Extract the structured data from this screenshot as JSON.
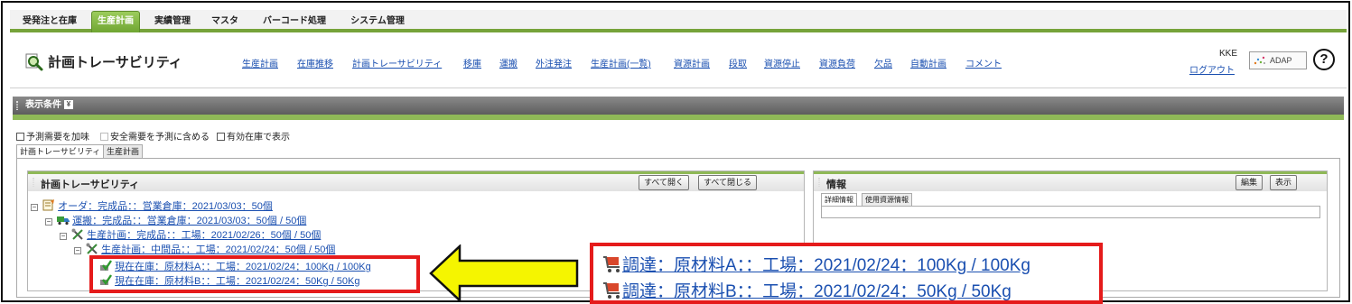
{
  "topnav": {
    "items": [
      {
        "label": "受発注と在庫",
        "active": false
      },
      {
        "label": "生産計画",
        "active": true
      },
      {
        "label": "実績管理",
        "active": false
      },
      {
        "label": "マスタ",
        "active": false
      },
      {
        "label": "バーコード処理",
        "active": false
      },
      {
        "label": "システム管理",
        "active": false
      }
    ]
  },
  "header": {
    "title": "計画トレーサビリティ",
    "title_icon": "magnifier-icon",
    "links": [
      "生産計画",
      "在庫推移",
      "計画トレーサビリティ",
      "移庫",
      "運搬",
      "外注発注",
      "生産計画(一覧)",
      "資源計画",
      "段取",
      "資源停止",
      "資源負荷",
      "欠品",
      "自動計画",
      "コメント"
    ],
    "user": "KKE",
    "logout": "ログアウト",
    "logo_text": "ADAP",
    "help": "?"
  },
  "conditions": {
    "bar_label": "表示条件",
    "toggle_glyph": "¥",
    "options": [
      {
        "label": "予測需要を加味",
        "checked": false,
        "enabled": true
      },
      {
        "label": "安全需要を予測に含める",
        "checked": false,
        "enabled": false
      },
      {
        "label": "有効在庫で表示",
        "checked": false,
        "enabled": true
      }
    ]
  },
  "tabs": [
    {
      "label": "計画トレーサビリティ",
      "active": true
    },
    {
      "label": "生産計画",
      "active": false
    }
  ],
  "trace_panel": {
    "title": "計画トレーサビリティ",
    "expand_all": "すべて開く",
    "collapse_all": "すべて閉じる",
    "tree": [
      {
        "text": "オーダ：完成品：：営業倉庫：2021/03/03：50個",
        "icon": "order-icon",
        "toggle": "⊟"
      },
      {
        "text": "運搬：完成品：：営業倉庫：2021/03/03：50個 / 50個",
        "icon": "truck-icon",
        "toggle": "⊟"
      },
      {
        "text": "生産計画：完成品：：工場：2021/02/26：50個 / 50個",
        "icon": "tools-icon",
        "toggle": "⊟"
      },
      {
        "text": "生産計画：中間品：：工場：2021/02/24：50個 / 50個",
        "icon": "tools-icon",
        "toggle": "⊟"
      },
      {
        "text": "現在在庫：原材料A：：工場：2021/02/24：100Kg / 100Kg",
        "icon": "stock-check-icon",
        "toggle": ""
      },
      {
        "text": "現在在庫：原材料B：：工場：2021/02/24：50Kg / 50Kg",
        "icon": "stock-check-icon",
        "toggle": ""
      }
    ]
  },
  "info_panel": {
    "title": "情報",
    "edit": "編集",
    "show": "表示",
    "tabs": [
      "詳細情報",
      "使用資源情報"
    ]
  },
  "callout": {
    "items": [
      {
        "text": "調達：原材料A：：工場：2021/02/24：100Kg / 100Kg",
        "icon": "cart-icon"
      },
      {
        "text": "調達：原材料B：：工場：2021/02/24：50Kg / 50Kg",
        "icon": "cart-icon"
      }
    ],
    "arrow_color": "#f5f500",
    "highlight_color": "#e51b1b"
  }
}
